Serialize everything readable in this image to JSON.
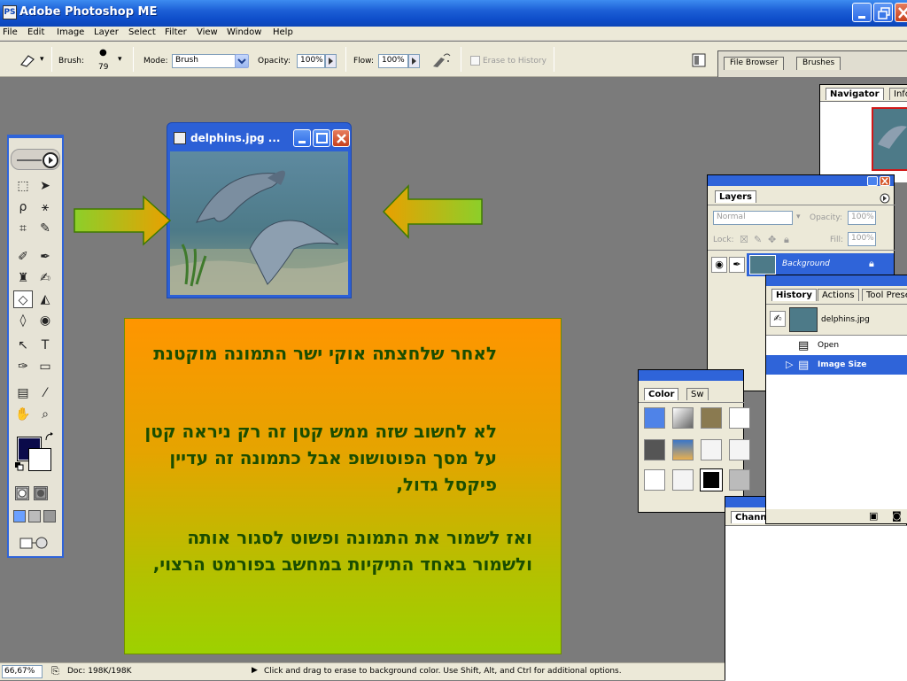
{
  "window": {
    "title": "Adobe Photoshop ME"
  },
  "menu": [
    "File",
    "Edit",
    "Image",
    "Layer",
    "Select",
    "Filter",
    "View",
    "Window",
    "Help"
  ],
  "options": {
    "brush_label": "Brush:",
    "brush_size": "79",
    "mode_label": "Mode:",
    "mode_value": "Brush",
    "opacity_label": "Opacity:",
    "opacity_value": "100%",
    "flow_label": "Flow:",
    "flow_value": "100%",
    "erase_history_label": "Erase to History",
    "tab_file_browser": "File Browser",
    "tab_brushes": "Brushes"
  },
  "document": {
    "title": "delphins.jpg ..."
  },
  "textbox": {
    "para1": "לאחר שלחצתה אוקי ישר התמונה מוקטנת",
    "para2": "לא לחשוב שזה ממש קטן זה רק ניראה קטן על מסך הפוטושופ אבל כתמונה זה עדיין פיקסל גדול,",
    "para3": "ואז לשמור את התמונה ופשוט לסגור אותה ולשמור באחד התיקיות במחשב בפורמט הרצוי,"
  },
  "navigator": {
    "tab_navigator": "Navigator",
    "tab_info": "Info"
  },
  "layers": {
    "tab": "Layers",
    "blend_mode": "Normal",
    "opacity_label": "Opacity:",
    "opacity_value": "100%",
    "lock_label": "Lock:",
    "fill_label": "Fill:",
    "fill_value": "100%",
    "layer_name": "Background"
  },
  "history": {
    "tab_history": "History",
    "tab_actions": "Actions",
    "tab_tool_presets": "Tool Prese",
    "snapshot": "delphins.jpg",
    "items": [
      "Open",
      "Image Size"
    ]
  },
  "color_panel": {
    "tab_color": "Color",
    "tab_swatches": "Sw"
  },
  "channels": {
    "tab": "Channe"
  },
  "status": {
    "zoom": "66,67%",
    "doc": "Doc: 198K/198K",
    "hint": "Click and drag to erase to background color.  Use Shift, Alt, and Ctrl for additional options."
  },
  "colors": {
    "titlebar": "#1c5fd6",
    "textbox_top": "#ff9500",
    "textbox_bottom": "#9dd100",
    "hebrew_text": "#1a4d00",
    "history_selected": "#2f64d9",
    "foreground": "#0a0a4a"
  }
}
